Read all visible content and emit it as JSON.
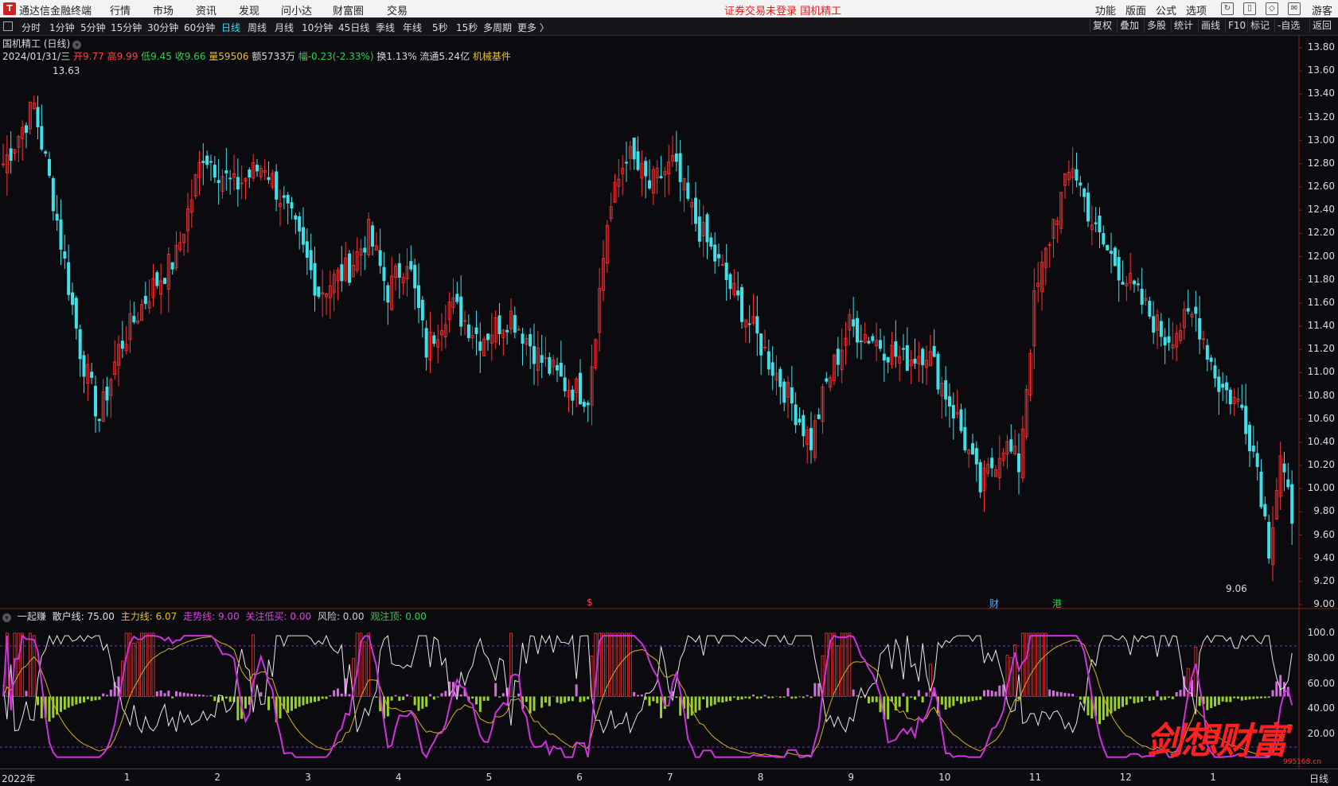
{
  "menu": {
    "app_name": "通达信金融终端",
    "items": [
      "行情",
      "市场",
      "资讯",
      "发现",
      "问小达",
      "财富圈",
      "交易"
    ],
    "notice": "证券交易未登录  国机精工",
    "right_items": [
      "功能",
      "版面",
      "公式",
      "选项"
    ],
    "far_right": "游客"
  },
  "toolbar": {
    "periods": [
      "分时",
      "1分钟",
      "5分钟",
      "15分钟",
      "30分钟",
      "60分钟",
      "日线",
      "周线",
      "月线",
      "10分钟",
      "45日线",
      "季线",
      "年线",
      "5秒",
      "15秒",
      "多周期",
      "更多 〉"
    ],
    "active": "日线",
    "right_buttons": [
      "复权",
      "叠加",
      "多股",
      "统计",
      "画线",
      "F10",
      "标记",
      "-自选",
      "返回"
    ]
  },
  "stock": {
    "title": "国机精工 (日线)",
    "date": "2024/01/31/三",
    "open_label": "开9.77",
    "high_label": "高9.99",
    "low_label": "低9.45",
    "close_label": "收9.66",
    "volume_label": "量59506",
    "amount_label": "额5733万",
    "change_label": "幅-0.23(-2.33%)",
    "turnover_label": "换1.13%",
    "float_label": "流通5.24亿",
    "sector": "机械基件",
    "high_mark": "13.63",
    "low_mark": "9.06",
    "markers": [
      "$",
      "财",
      "港"
    ]
  },
  "indicator": {
    "name": "一起赚",
    "items": [
      {
        "label": "散户线: 75.00",
        "color": "#e0e0e0"
      },
      {
        "label": "主力线: 6.07",
        "color": "#e8c020"
      },
      {
        "label": "走势线: 9.00",
        "color": "#e040e0"
      },
      {
        "label": "关注低买: 0.00",
        "color": "#e040e0"
      },
      {
        "label": "风险: 0.00",
        "color": "#cfcfcf"
      },
      {
        "label": "观注顶: 0.00",
        "color": "#2ad24a"
      }
    ]
  },
  "axis": {
    "price_ticks": [
      "13.80",
      "13.60",
      "13.40",
      "13.20",
      "13.00",
      "12.80",
      "12.60",
      "12.40",
      "12.20",
      "12.00",
      "11.80",
      "11.60",
      "11.40",
      "11.20",
      "11.00",
      "10.80",
      "10.60",
      "10.40",
      "10.20",
      "10.00",
      "9.80",
      "9.60",
      "9.40",
      "9.20",
      "9.00"
    ],
    "ind_ticks": [
      "100.0",
      "80.00",
      "60.00",
      "40.00",
      "20.00"
    ],
    "months": [
      "2022年",
      "1",
      "2",
      "3",
      "4",
      "5",
      "6",
      "7",
      "8",
      "9",
      "10",
      "11",
      "12",
      "1"
    ],
    "period_label": "日线"
  },
  "watermark": {
    "text": "剑想财富",
    "site": "995168.cn"
  },
  "colors": {
    "up": "#ff3030",
    "down": "#40e0e8",
    "bg": "#0b0b0f",
    "accent": "#3ad4ff"
  },
  "chart_data": {
    "type": "candlestick",
    "ylim": [
      9.0,
      13.8
    ],
    "close_anchors": [
      {
        "i": 0,
        "c": 12.8
      },
      {
        "i": 8,
        "c": 13.3
      },
      {
        "i": 13,
        "c": 12.5
      },
      {
        "i": 20,
        "c": 11.2
      },
      {
        "i": 25,
        "c": 10.6
      },
      {
        "i": 30,
        "c": 11.2
      },
      {
        "i": 38,
        "c": 11.7
      },
      {
        "i": 45,
        "c": 12.0
      },
      {
        "i": 52,
        "c": 12.9
      },
      {
        "i": 60,
        "c": 12.6
      },
      {
        "i": 68,
        "c": 12.8
      },
      {
        "i": 75,
        "c": 12.3
      },
      {
        "i": 82,
        "c": 11.7
      },
      {
        "i": 90,
        "c": 11.9
      },
      {
        "i": 95,
        "c": 12.2
      },
      {
        "i": 100,
        "c": 11.7
      },
      {
        "i": 105,
        "c": 12.0
      },
      {
        "i": 110,
        "c": 11.2
      },
      {
        "i": 116,
        "c": 11.6
      },
      {
        "i": 124,
        "c": 11.3
      },
      {
        "i": 132,
        "c": 11.5
      },
      {
        "i": 140,
        "c": 11.1
      },
      {
        "i": 146,
        "c": 10.9
      },
      {
        "i": 152,
        "c": 10.8
      },
      {
        "i": 157,
        "c": 12.3
      },
      {
        "i": 162,
        "c": 12.9
      },
      {
        "i": 168,
        "c": 12.6
      },
      {
        "i": 174,
        "c": 12.8
      },
      {
        "i": 180,
        "c": 12.3
      },
      {
        "i": 188,
        "c": 11.8
      },
      {
        "i": 196,
        "c": 11.3
      },
      {
        "i": 204,
        "c": 10.8
      },
      {
        "i": 210,
        "c": 10.4
      },
      {
        "i": 214,
        "c": 10.9
      },
      {
        "i": 220,
        "c": 11.4
      },
      {
        "i": 226,
        "c": 11.3
      },
      {
        "i": 234,
        "c": 11.1
      },
      {
        "i": 240,
        "c": 11.2
      },
      {
        "i": 248,
        "c": 10.6
      },
      {
        "i": 254,
        "c": 10.0
      },
      {
        "i": 260,
        "c": 10.4
      },
      {
        "i": 264,
        "c": 10.2
      },
      {
        "i": 268,
        "c": 11.6
      },
      {
        "i": 273,
        "c": 12.3
      },
      {
        "i": 278,
        "c": 12.8
      },
      {
        "i": 284,
        "c": 12.2
      },
      {
        "i": 290,
        "c": 11.9
      },
      {
        "i": 296,
        "c": 11.6
      },
      {
        "i": 302,
        "c": 11.3
      },
      {
        "i": 310,
        "c": 11.5
      },
      {
        "i": 316,
        "c": 10.9
      },
      {
        "i": 322,
        "c": 10.7
      },
      {
        "i": 326,
        "c": 10.2
      },
      {
        "i": 329,
        "c": 9.5
      },
      {
        "i": 332,
        "c": 10.3
      },
      {
        "i": 335,
        "c": 9.7
      }
    ],
    "indicator_ylim": [
      0,
      110
    ]
  }
}
